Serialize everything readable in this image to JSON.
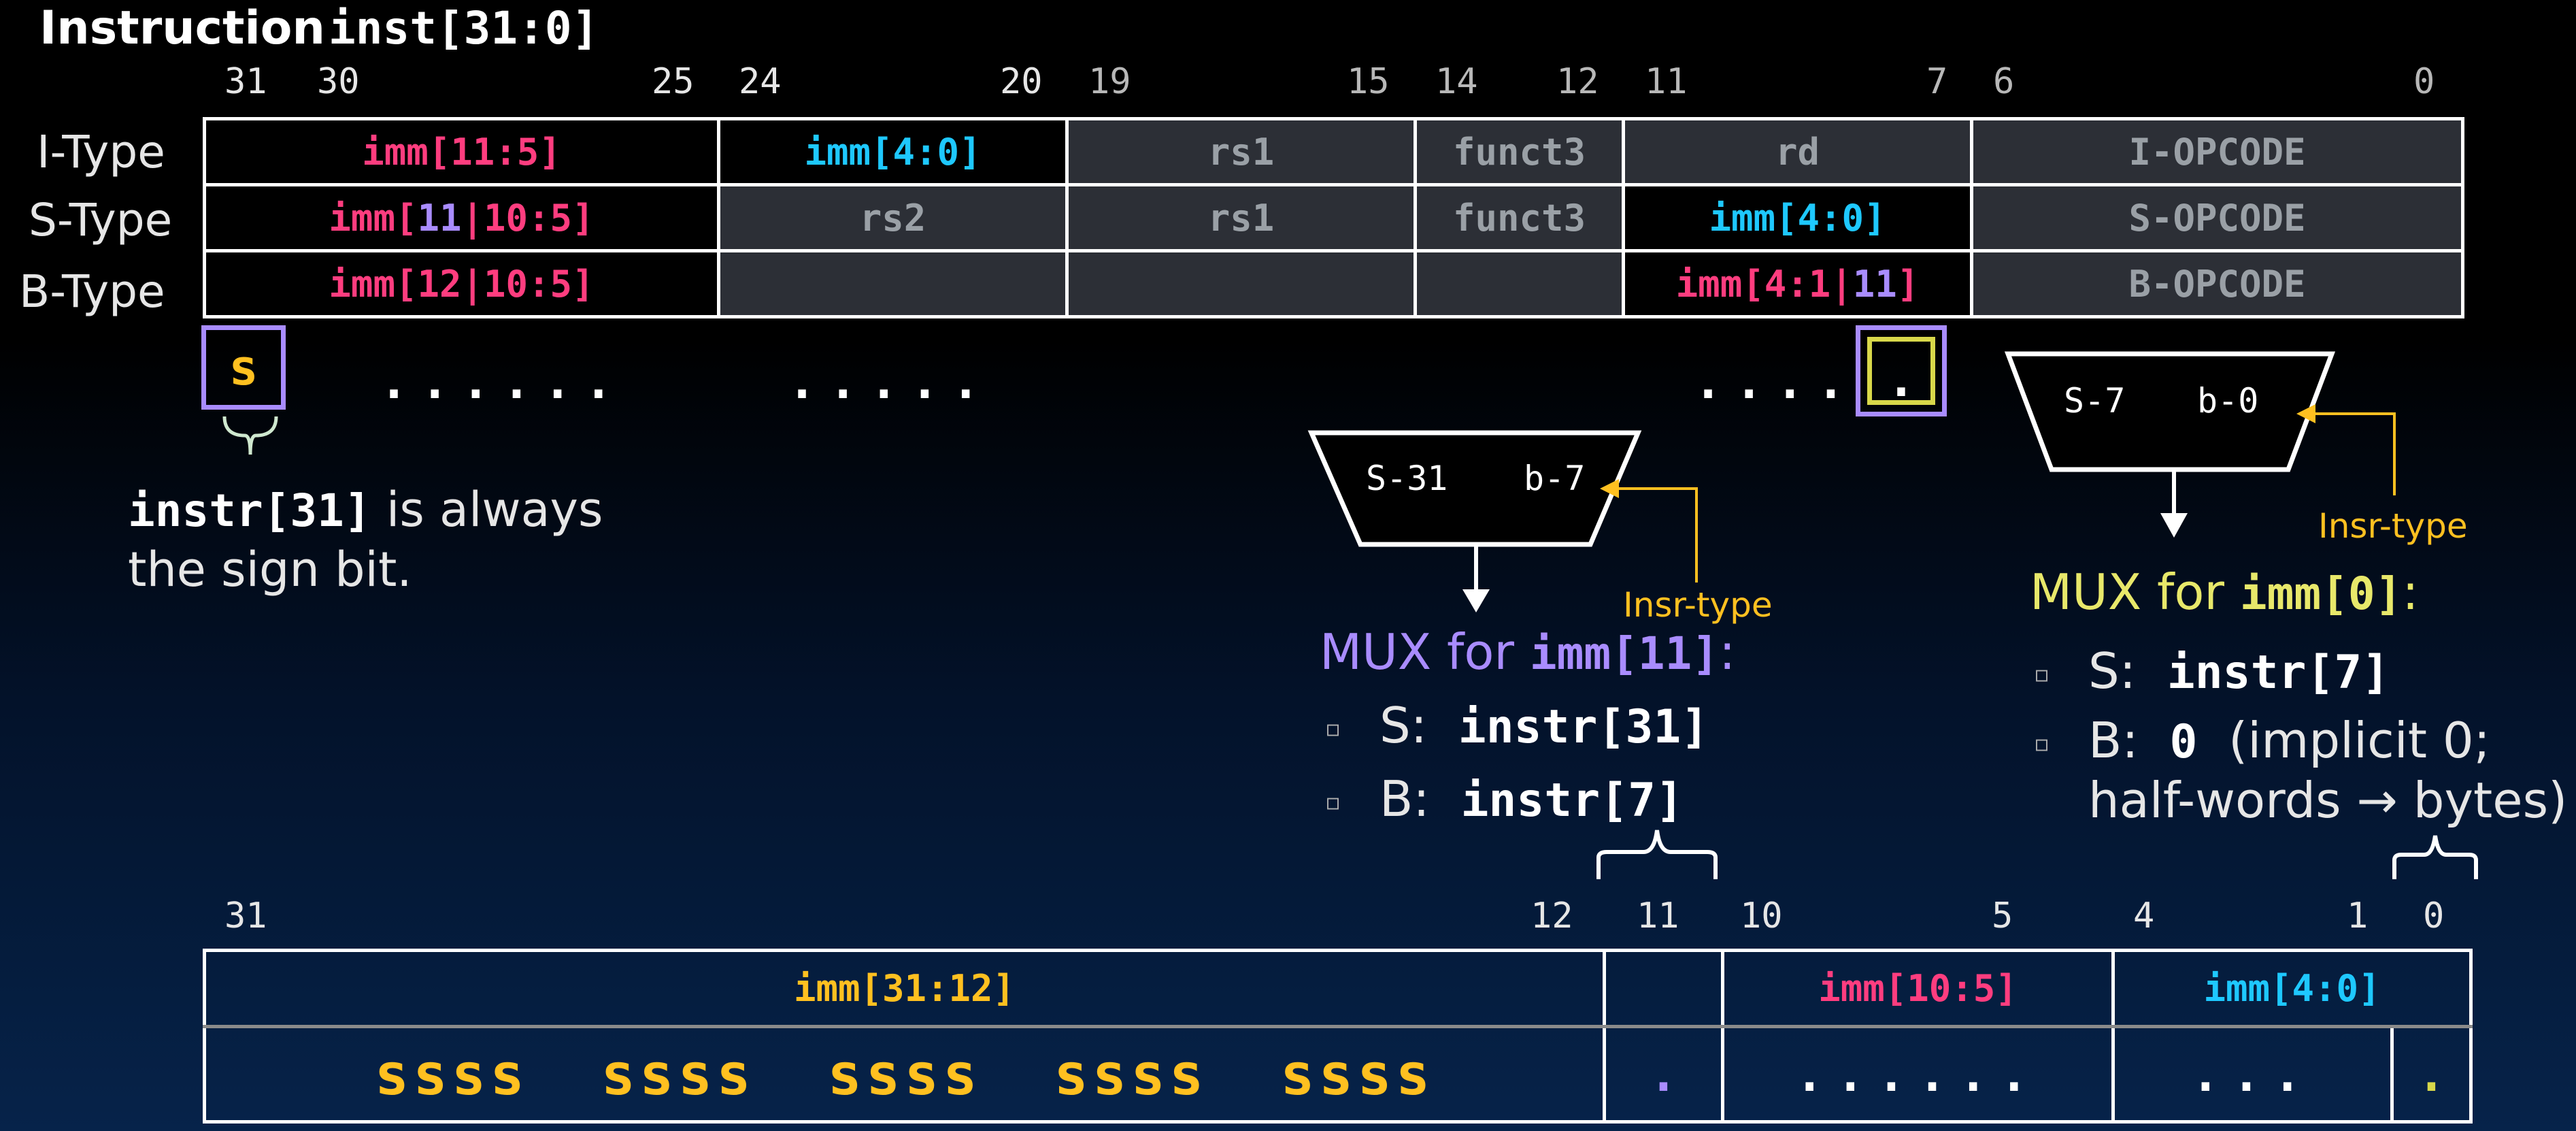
{
  "title": {
    "word": "Instruction",
    "code": "inst[31:0]"
  },
  "top_bits": [
    "31",
    "30",
    "25",
    "24",
    "20",
    "19",
    "15",
    "14",
    "12",
    "11",
    "7",
    "6",
    "0"
  ],
  "types": [
    "I-Type",
    "S-Type",
    "B-Type"
  ],
  "rows": {
    "i": {
      "c1": "imm[11:5]",
      "c2": "imm[4:0]",
      "c3": "rs1",
      "c4": "funct3",
      "c5": "rd",
      "c6": "I-OPCODE"
    },
    "s": {
      "c1a": "imm[",
      "c1b": "11",
      "c1c": "|10:5]",
      "c2": "rs2",
      "c3": "rs1",
      "c4": "funct3",
      "c5": "imm[4:0]",
      "c6": "S-OPCODE"
    },
    "b": {
      "c1": "imm[12|10:5]",
      "c5a": "imm[4:1|",
      "c5b": "11",
      "c5c": "]",
      "c6": "B-OPCODE"
    }
  },
  "sign_box": "s",
  "dots": {
    "d1": "......",
    "d2": ".....",
    "d3": "....",
    "d4": "."
  },
  "sign_note": {
    "code": "instr[31]",
    "text1": " is always",
    "text2": "the sign bit."
  },
  "mux11": {
    "in_s": "S-31",
    "in_b": "b-7",
    "sel": "Insr-type",
    "head_text": "MUX for ",
    "head_code": "imm[11]",
    "head_colon": ":",
    "b1_label": "S:",
    "b1_code": "instr[31]",
    "b2_label": "B:",
    "b2_code": "instr[7]"
  },
  "mux0": {
    "in_s": "S-7",
    "in_b": "b-0",
    "sel": "Insr-type",
    "head_text": "MUX for ",
    "head_code": "imm[0]",
    "head_colon": ":",
    "b1_label": "S:",
    "b1_code": "instr[7]",
    "b2_label": "B:",
    "b2_code": "0",
    "b2_rest1": "(implicit 0;",
    "b2_rest2": "half-words → bytes)"
  },
  "bottom_bits": [
    "31",
    "12",
    "11",
    "10",
    "5",
    "4",
    "1",
    "0"
  ],
  "imm": {
    "c1": "imm[31:12]",
    "c3": "imm[10:5]",
    "c4": "imm[4:0]",
    "ssss": "ssss ssss ssss ssss ssss",
    "dot11": ".",
    "dots10_5": "......",
    "dots4_1": "...",
    "dot0": "."
  },
  "colors": {
    "pink": "#ff3d7f",
    "cyan": "#1ec8ff",
    "purple": "#a98cff",
    "yellow": "#ffc020",
    "olive": "#d8d84a"
  }
}
